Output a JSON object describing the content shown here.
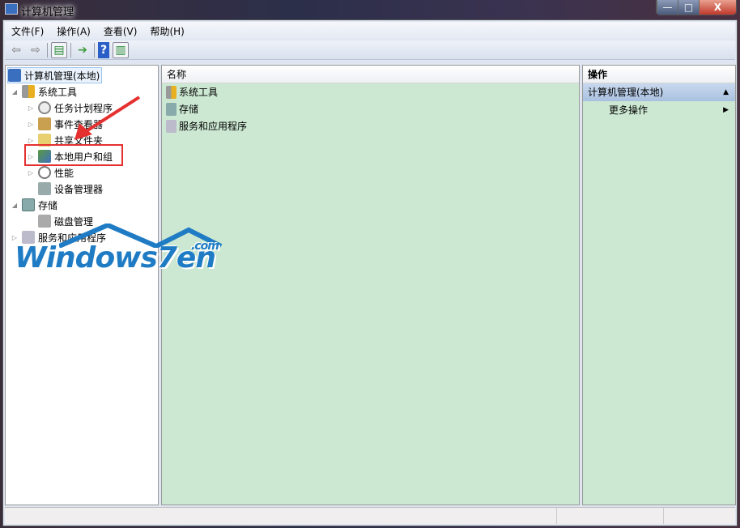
{
  "window": {
    "title": "计算机管理",
    "buttons": {
      "minimize": "—",
      "maximize": "□",
      "close": "X"
    }
  },
  "menu": [
    "文件(F)",
    "操作(A)",
    "查看(V)",
    "帮助(H)"
  ],
  "toolbar": {
    "icons": [
      "back-arrow-icon",
      "forward-arrow-icon",
      "show-hide-console-tree-icon",
      "export-list-icon",
      "help-icon",
      "show-hide-action-pane-icon"
    ]
  },
  "tree": {
    "root": "计算机管理(本地)",
    "items": [
      {
        "label": "系统工具",
        "level": 1,
        "expanded": true
      },
      {
        "label": "任务计划程序",
        "level": 2
      },
      {
        "label": "事件查看器",
        "level": 2
      },
      {
        "label": "共享文件夹",
        "level": 2
      },
      {
        "label": "本地用户和组",
        "level": 2,
        "highlighted": true
      },
      {
        "label": "性能",
        "level": 2
      },
      {
        "label": "设备管理器",
        "level": 2
      },
      {
        "label": "存储",
        "level": 1,
        "expanded": true
      },
      {
        "label": "磁盘管理",
        "level": 2
      },
      {
        "label": "服务和应用程序",
        "level": 1
      }
    ]
  },
  "list": {
    "column": "名称",
    "rows": [
      "系统工具",
      "存储",
      "服务和应用程序"
    ]
  },
  "actions": {
    "header": "操作",
    "section": "计算机管理(本地)",
    "more": "更多操作"
  },
  "watermark": {
    "text": "Windows7en",
    "suffix": ".com"
  },
  "colors": {
    "pane_bg": "#cce8d2",
    "annotation": "#e53030",
    "watermark": "#1f7cc4"
  }
}
